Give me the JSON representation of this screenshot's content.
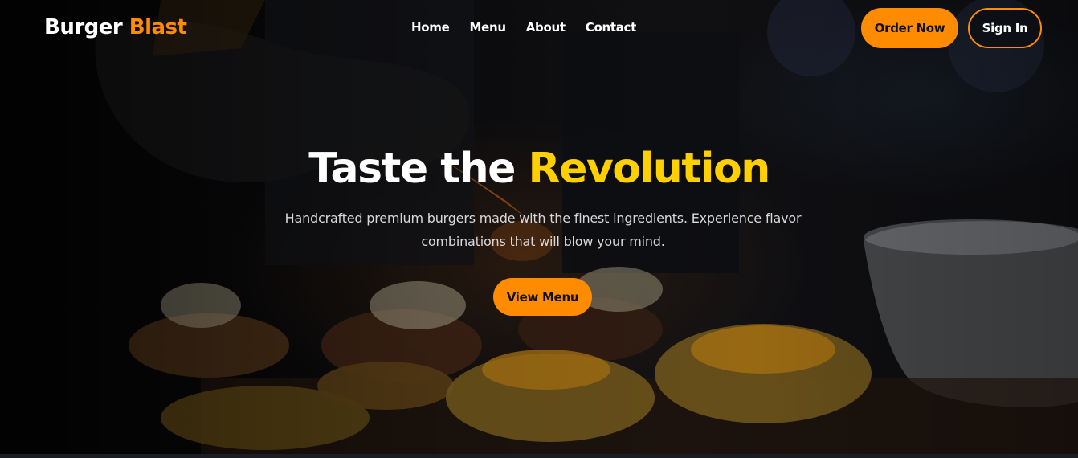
{
  "brand": {
    "name": "Burger",
    "accent": "Blast"
  },
  "nav": {
    "links": [
      {
        "label": "Home"
      },
      {
        "label": "Menu"
      },
      {
        "label": "About"
      },
      {
        "label": "Contact"
      }
    ],
    "order_label": "Order Now",
    "signin_label": "Sign In"
  },
  "hero": {
    "title_main": "Taste the ",
    "title_accent": "Revolution",
    "subtitle": "Handcrafted premium burgers made with the finest ingredients. Experience flavor combinations that will blow your mind.",
    "cta_label": "View Menu"
  },
  "colors": {
    "accent": "#ff8c00",
    "highlight": "#ffd000",
    "text": "#ffffff"
  }
}
